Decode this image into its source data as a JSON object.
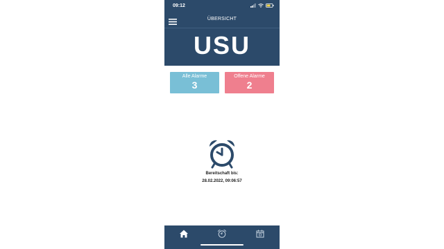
{
  "status_bar": {
    "time": "09:12"
  },
  "header": {
    "title": "ÜBERSICHT",
    "logo_text": "USU"
  },
  "cards": [
    {
      "label": "Alle Alarme",
      "count": "3",
      "color": "#79bfd6"
    },
    {
      "label": "Offene Alarme",
      "count": "2",
      "color": "#ef7f8e"
    }
  ],
  "standby": {
    "label": "Bereitschaft bis:",
    "value": "28.02.2022, 09:06:57"
  },
  "bottom_nav": [
    {
      "icon": "home-icon"
    },
    {
      "icon": "alarm-clock-icon"
    },
    {
      "icon": "calendar-icon"
    }
  ],
  "colors": {
    "primary": "#2c4a6a",
    "accent_blue": "#79bfd6",
    "accent_red": "#ef7f8e"
  }
}
